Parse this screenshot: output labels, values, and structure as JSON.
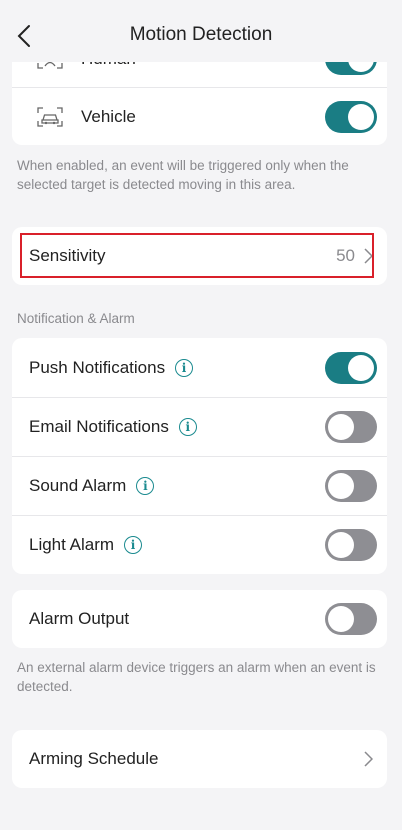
{
  "header": {
    "title": "Motion Detection"
  },
  "targets": [
    {
      "label": "Human",
      "enabled": true,
      "icon": "human-detect-icon"
    },
    {
      "label": "Vehicle",
      "enabled": true,
      "icon": "vehicle-detect-icon"
    }
  ],
  "targets_note": "When enabled, an event will be triggered only when the selected target is detected moving in this area.",
  "sensitivity": {
    "label": "Sensitivity",
    "value": "50"
  },
  "notification_section": "Notification & Alarm",
  "notifications": [
    {
      "label": "Push Notifications",
      "enabled": true
    },
    {
      "label": "Email Notifications",
      "enabled": false
    },
    {
      "label": "Sound Alarm",
      "enabled": false
    },
    {
      "label": "Light Alarm",
      "enabled": false
    }
  ],
  "alarm_output": {
    "label": "Alarm Output",
    "enabled": false
  },
  "alarm_output_note": "An external alarm device triggers an alarm when an event is detected.",
  "arming_schedule": {
    "label": "Arming Schedule"
  },
  "colors": {
    "accent": "#1a7d84",
    "highlight": "#d9202a"
  }
}
